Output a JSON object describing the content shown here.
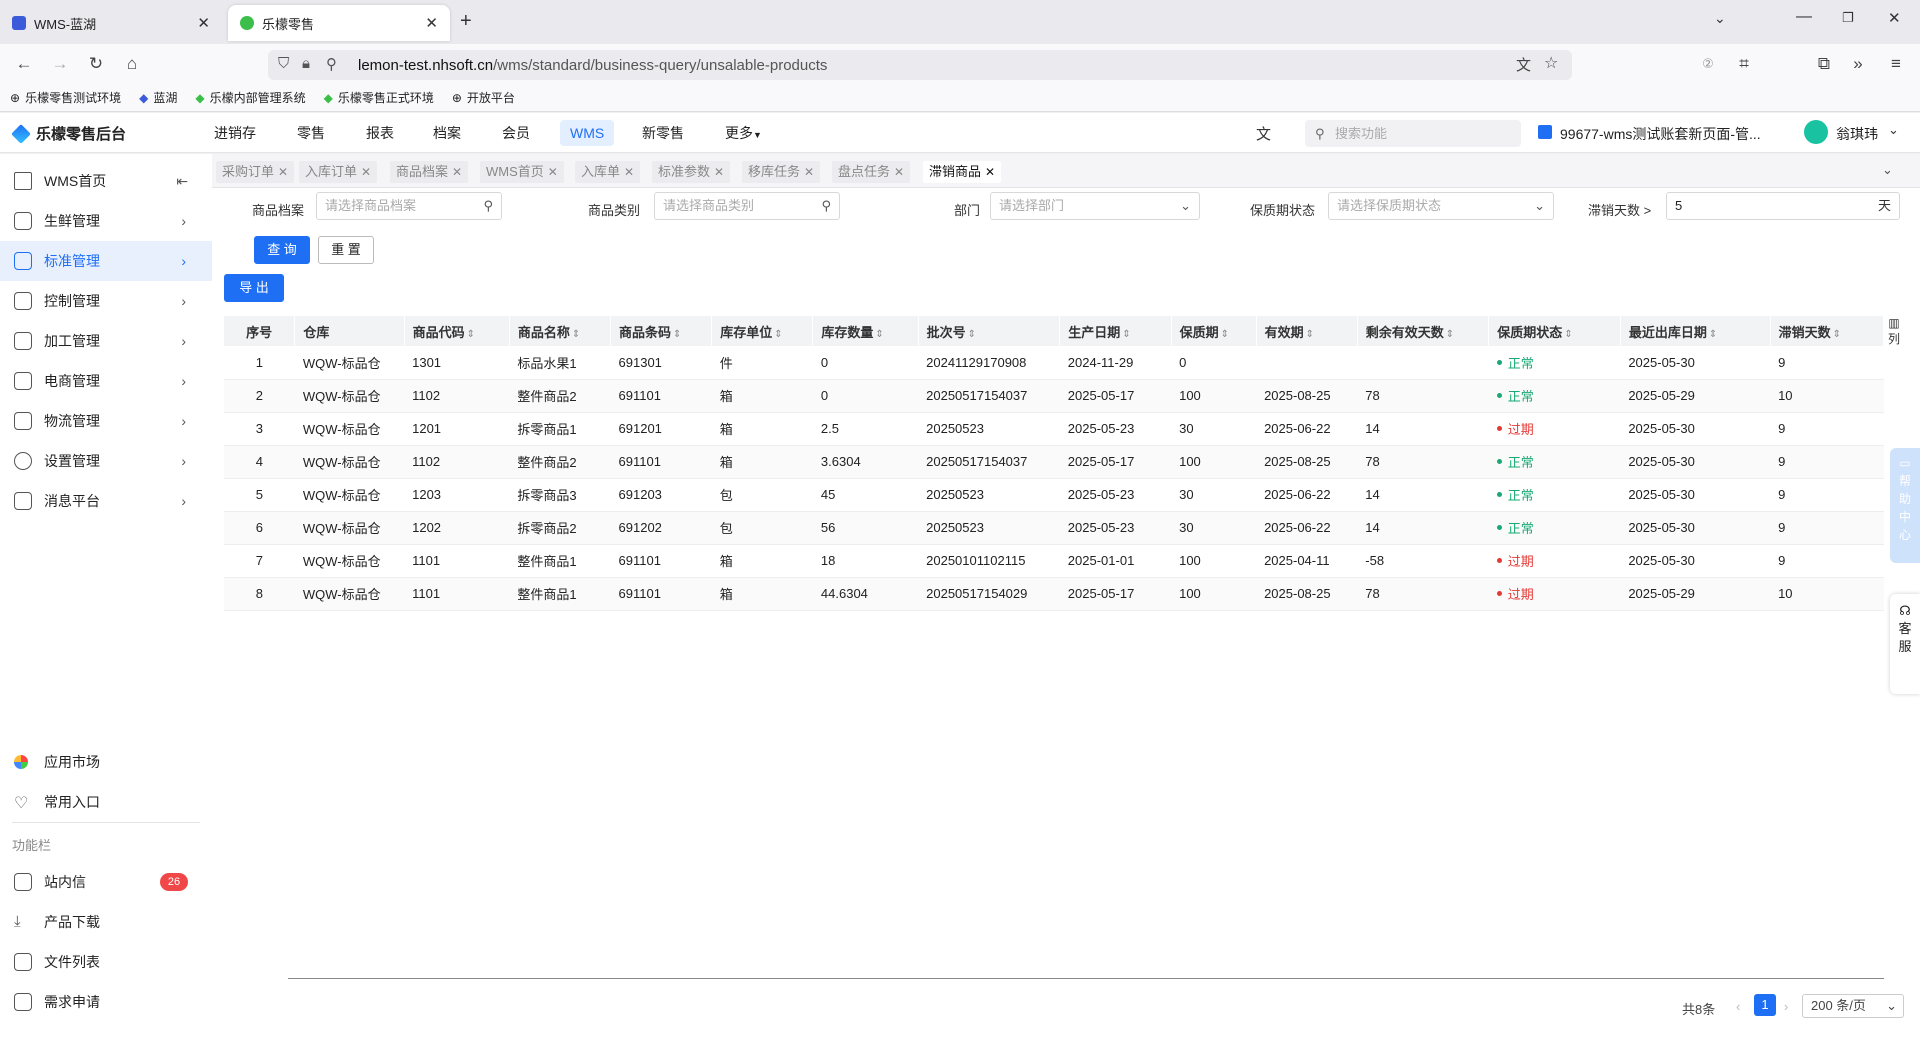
{
  "browser": {
    "tabs": [
      {
        "title": "WMS-蓝湖"
      },
      {
        "title": "乐檬零售"
      }
    ],
    "new_tab": "+",
    "url_host": "lemon-test.nhsoft.cn",
    "url_path": "/wms/standard/business-query/unsalable-products",
    "bookmarks": [
      "乐檬零售测试环境",
      "蓝湖",
      "乐檬内部管理系统",
      "乐檬零售正式环境",
      "开放平台"
    ]
  },
  "header": {
    "logo": "乐檬零售后台",
    "nav": [
      "进销存",
      "零售",
      "报表",
      "档案",
      "会员",
      "WMS",
      "新零售",
      "更多"
    ],
    "active_nav": "WMS",
    "search_placeholder": "搜索功能",
    "account": "99677-wms测试账套新页面-管...",
    "user": "翁琪玮"
  },
  "sidebar": {
    "items": [
      "WMS首页",
      "生鲜管理",
      "标准管理",
      "控制管理",
      "加工管理",
      "电商管理",
      "物流管理",
      "设置管理",
      "消息平台"
    ],
    "active": "标准管理",
    "bottom": [
      "应用市场",
      "常用入口"
    ],
    "section_title": "功能栏",
    "tools": [
      "站内信",
      "产品下载",
      "文件列表",
      "需求申请"
    ],
    "badge": "26"
  },
  "page_tabs": [
    "采购订单",
    "入库订单",
    "商品档案",
    "WMS首页",
    "入库单",
    "标准参数",
    "移库任务",
    "盘点任务",
    "滞销商品"
  ],
  "active_page_tab": "滞销商品",
  "filters": {
    "product_label": "商品档案",
    "product_placeholder": "请选择商品档案",
    "category_label": "商品类别",
    "category_placeholder": "请选择商品类别",
    "dept_label": "部门",
    "dept_placeholder": "请选择部门",
    "shelf_label": "保质期状态",
    "shelf_placeholder": "请选择保质期状态",
    "days_label": "滞销天数 >",
    "days_value": "5",
    "days_unit": "天",
    "query": "查 询",
    "reset": "重 置",
    "export": "导 出"
  },
  "table": {
    "columns": [
      "序号",
      "仓库",
      "商品代码",
      "商品名称",
      "商品条码",
      "库存单位",
      "库存数量",
      "批次号",
      "生产日期",
      "保质期",
      "有效期",
      "剩余有效天数",
      "保质期状态",
      "最近出库日期",
      "滞销天数"
    ],
    "sortable": [
      false,
      false,
      true,
      true,
      true,
      true,
      true,
      true,
      true,
      true,
      true,
      true,
      true,
      true,
      true
    ],
    "col_settings": "列",
    "rows": [
      [
        "1",
        "WQW-标品仓",
        "1301",
        "标品水果1",
        "691301",
        "件",
        "0",
        "20241129170908",
        "2024-11-29",
        "0",
        "",
        "",
        "正常",
        "2025-05-30",
        "9"
      ],
      [
        "2",
        "WQW-标品仓",
        "1102",
        "整件商品2",
        "691101",
        "箱",
        "0",
        "20250517154037",
        "2025-05-17",
        "100",
        "2025-08-25",
        "78",
        "正常",
        "2025-05-29",
        "10"
      ],
      [
        "3",
        "WQW-标品仓",
        "1201",
        "拆零商品1",
        "691201",
        "箱",
        "2.5",
        "20250523",
        "2025-05-23",
        "30",
        "2025-06-22",
        "14",
        "过期",
        "2025-05-30",
        "9"
      ],
      [
        "4",
        "WQW-标品仓",
        "1102",
        "整件商品2",
        "691101",
        "箱",
        "3.6304",
        "20250517154037",
        "2025-05-17",
        "100",
        "2025-08-25",
        "78",
        "正常",
        "2025-05-30",
        "9"
      ],
      [
        "5",
        "WQW-标品仓",
        "1203",
        "拆零商品3",
        "691203",
        "包",
        "45",
        "20250523",
        "2025-05-23",
        "30",
        "2025-06-22",
        "14",
        "正常",
        "2025-05-30",
        "9"
      ],
      [
        "6",
        "WQW-标品仓",
        "1202",
        "拆零商品2",
        "691202",
        "包",
        "56",
        "20250523",
        "2025-05-23",
        "30",
        "2025-06-22",
        "14",
        "正常",
        "2025-05-30",
        "9"
      ],
      [
        "7",
        "WQW-标品仓",
        "1101",
        "整件商品1",
        "691101",
        "箱",
        "18",
        "20250101102115",
        "2025-01-01",
        "100",
        "2025-04-11",
        "-58",
        "过期",
        "2025-05-30",
        "9"
      ],
      [
        "8",
        "WQW-标品仓",
        "1101",
        "整件商品1",
        "691101",
        "箱",
        "44.6304",
        "20250517154029",
        "2025-05-17",
        "100",
        "2025-08-25",
        "78",
        "过期",
        "2025-05-29",
        "10"
      ]
    ],
    "status_colors": {
      "正常": "#19a974",
      "过期": "#e53935"
    }
  },
  "pagination": {
    "total": "共8条",
    "current": "1",
    "page_size": "200 条/页"
  },
  "float": {
    "help": [
      "帮",
      "助",
      "中",
      "心"
    ],
    "service": [
      "客",
      "服"
    ]
  },
  "colors": {
    "accent": "#1e6ff3"
  }
}
